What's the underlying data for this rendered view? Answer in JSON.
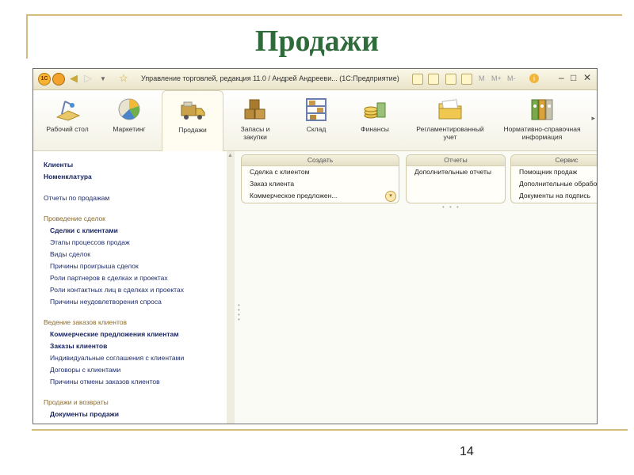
{
  "slide": {
    "title": "Продажи",
    "page_number": "14"
  },
  "window": {
    "title": "Управление торговлей, редакция 11.0 / Андрей Андрееви...  (1С:Предприятие)",
    "logo_text": "1С",
    "controls": {
      "memory": "M",
      "memory_plus": "M+",
      "memory_minus": "M-",
      "info": "i",
      "minimize": "–",
      "maximize": "□",
      "close": "✕"
    }
  },
  "sections": [
    {
      "label": "Рабочий стол",
      "icon": "desk-lamp-icon"
    },
    {
      "label": "Маркетинг",
      "icon": "pie-chart-icon"
    },
    {
      "label": "Продажи",
      "icon": "truck-icon",
      "active": true
    },
    {
      "label": "Запасы и закупки",
      "icon": "boxes-icon"
    },
    {
      "label": "Склад",
      "icon": "warehouse-shelf-icon"
    },
    {
      "label": "Финансы",
      "icon": "coins-icon"
    },
    {
      "label": "Регламентированный учет",
      "icon": "folder-icon"
    },
    {
      "label": "Нормативно-справочная информация",
      "icon": "binders-icon"
    }
  ],
  "nav": {
    "top_items": [
      "Клиенты",
      "Номенклатура"
    ],
    "reports_link": "Отчеты по продажам",
    "groups": [
      {
        "title": "Проведение сделок",
        "items": [
          {
            "label": "Сделки с клиентами",
            "bold": true
          },
          {
            "label": "Этапы процессов продаж",
            "bold": false
          },
          {
            "label": "Виды сделок",
            "bold": false
          },
          {
            "label": "Причины проигрыша сделок",
            "bold": false
          },
          {
            "label": "Роли партнеров в сделках и проектах",
            "bold": false
          },
          {
            "label": "Роли контактных лиц в сделках и проектах",
            "bold": false
          },
          {
            "label": "Причины неудовлетворения спроса",
            "bold": false
          }
        ]
      },
      {
        "title": "Ведение заказов клиентов",
        "items": [
          {
            "label": "Коммерческие предложения клиентам",
            "bold": true
          },
          {
            "label": "Заказы клиентов",
            "bold": true
          },
          {
            "label": "Индивидуальные соглашения с клиентами",
            "bold": false
          },
          {
            "label": "Договоры с клиентами",
            "bold": false
          },
          {
            "label": "Причины отмены заказов клиентов",
            "bold": false
          }
        ]
      },
      {
        "title": "Продажи и возвраты",
        "items": [
          {
            "label": "Документы продажи",
            "bold": true
          }
        ]
      }
    ]
  },
  "panels": {
    "create": {
      "title": "Создать",
      "items": [
        "Сделка с клиентом",
        "Заказ клиента",
        "Коммерческое предложен..."
      ]
    },
    "reports": {
      "title": "Отчеты",
      "items": [
        "Дополнительные отчеты"
      ]
    },
    "service": {
      "title": "Сервис",
      "items": [
        "Помощник продаж",
        "Дополнительные обработки",
        "Документы на подпись"
      ]
    }
  },
  "colors": {
    "title_green": "#2f6b3a",
    "frame_gold": "#d4bd7a",
    "nav_link": "#1f2d6b",
    "group_brown": "#8a6a2a"
  }
}
